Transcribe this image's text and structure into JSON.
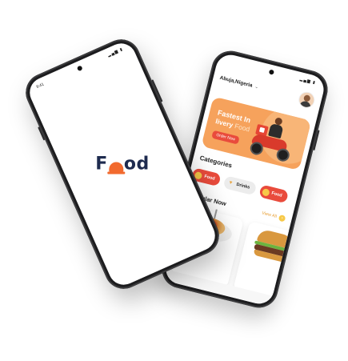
{
  "splash": {
    "logo_letters": [
      "F",
      "od"
    ],
    "status_time": "9:41"
  },
  "home": {
    "location": "Abuja,Nigeria",
    "banner": {
      "title": "Fastest In",
      "subtitle": "livery",
      "subtitle_highlight": "Food",
      "order_button": "Order Now"
    },
    "categories_title": "Categories",
    "categories": [
      {
        "label": "Food",
        "icon": "burger-icon"
      },
      {
        "label": "Drinks",
        "icon": "drink-icon"
      },
      {
        "label": "Food",
        "icon": "burger-icon"
      }
    ],
    "popular_title": "Popular Now",
    "view_all": "View All"
  },
  "colors": {
    "brand_orange": "#f26a2e",
    "banner": "#f6a25c",
    "chip_red": "#e94b3c",
    "accent_yellow": "#f7c948",
    "logo_navy": "#1e2b4f"
  }
}
